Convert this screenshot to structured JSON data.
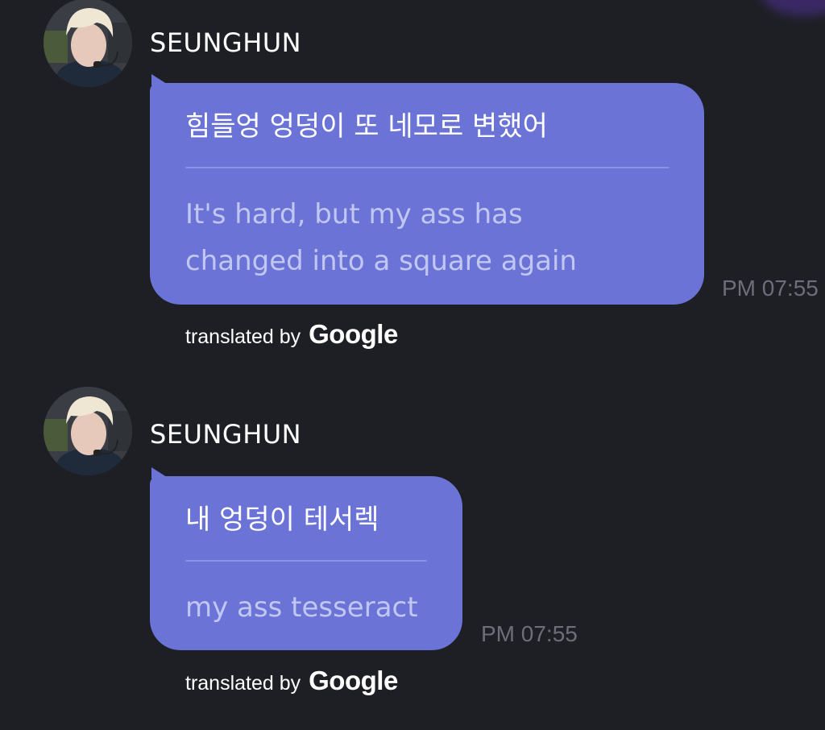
{
  "theme": {
    "background": "#1e1f25",
    "bubble_color": "#6b74d6",
    "translated_text_color": "#c2c7f2",
    "timestamp_color": "#6c6f7a"
  },
  "messages": [
    {
      "sender": "SEUNGHUN",
      "avatar_icon": "user-avatar-photo",
      "original_text": "힘들엉 엉덩이 또 네모로 변했어",
      "translated_text": "It's hard, but my ass has changed into a square again",
      "timestamp": "PM 07:55",
      "attribution_prefix": "translated by",
      "attribution_brand": "Google"
    },
    {
      "sender": "SEUNGHUN",
      "avatar_icon": "user-avatar-photo",
      "original_text": "내 엉덩이 테서렉",
      "translated_text": "my ass tesseract",
      "timestamp": "PM 07:55",
      "attribution_prefix": "translated by",
      "attribution_brand": "Google"
    }
  ]
}
